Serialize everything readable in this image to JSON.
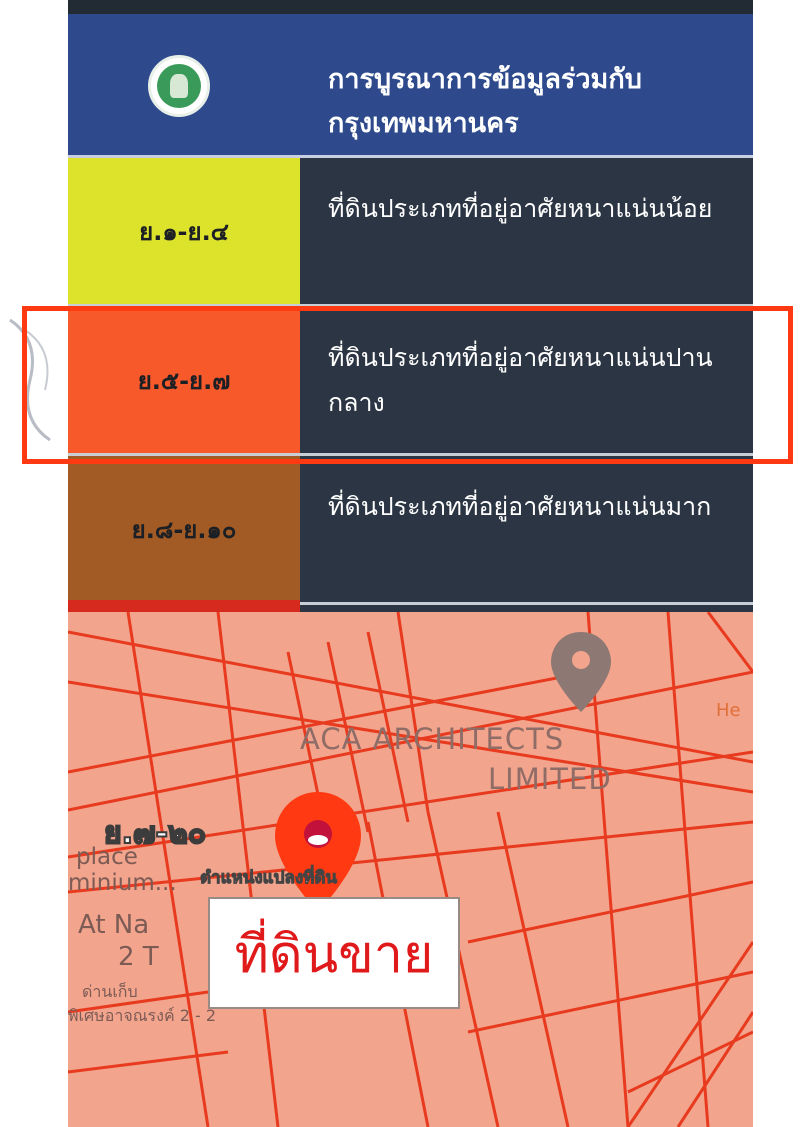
{
  "legend": {
    "header": {
      "title": "การบูรณาการข้อมูลร่วมกับ กรุงเทพมหานคร",
      "logo_icon": "bangkok-seal-icon"
    },
    "rows": [
      {
        "code": "ย.๑-ย.๔",
        "label": "ที่ดินประเภทที่อยู่อาศัยหนาแน่นน้อย",
        "color": "#dde32a"
      },
      {
        "code": "ย.๕-ย.๗",
        "label": "ที่ดินประเภทที่อยู่อาศัยหนาแน่นปานกลาง",
        "color": "#f7592b"
      },
      {
        "code": "ย.๘-ย.๑๐",
        "label": "ที่ดินประเภทที่อยู่อาศัยหนาแน่นมาก",
        "color": "#a35b26"
      }
    ],
    "highlight_color": "#ff3a12"
  },
  "map": {
    "background_color": "#f2a48d",
    "line_color": "#e83a1e",
    "poi_label_1": "ACA ARCHITECTS",
    "poi_label_2": "LIMITED",
    "zone_code": "ย.๗-๒๐",
    "plot_label": "ตำแหน่งแปลงที่ดิน",
    "sale_label": "ที่ดินขาย",
    "partial_labels": {
      "place": "place",
      "minium": "minium...",
      "atna": "At Na",
      "two": "2 T",
      "thai_small_1": "ด่านเก็บ",
      "thai_small_2": "พิเศษอาจณรงค์ 2 - 2",
      "edge": "He"
    },
    "marker_icon": "map-pin-icon",
    "poi_icon": "poi-pin-icon"
  }
}
